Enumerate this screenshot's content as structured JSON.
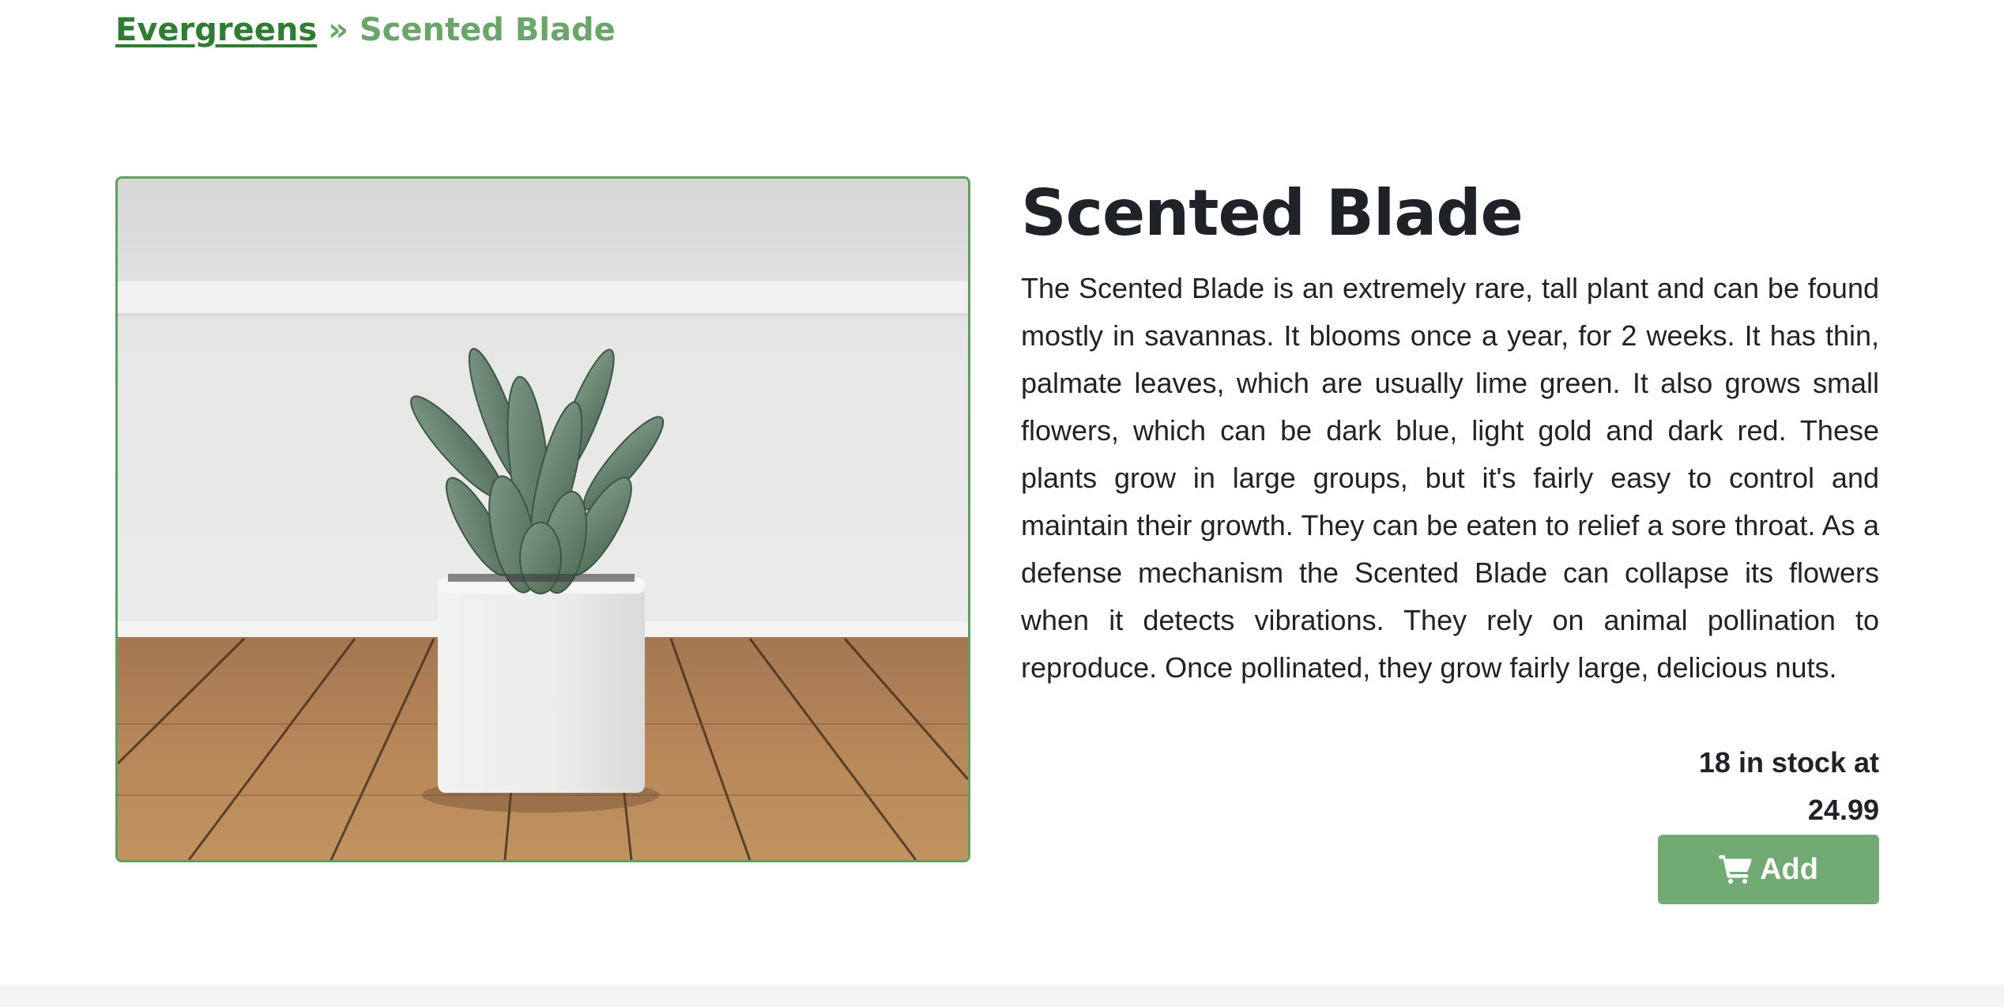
{
  "breadcrumb": {
    "parent_label": "Evergreens",
    "separator": " » ",
    "current_label": "Scented Blade"
  },
  "product": {
    "title": "Scented Blade",
    "image_description": "Succulent in a white square pot on a wooden floor",
    "description": "The Scented Blade is an extremely rare, tall plant and can be found mostly in savannas. It blooms once a year, for 2 weeks. It has thin, palmate leaves, which are usually lime green. It also grows small flowers, which can be dark blue, light gold and dark red. These plants grow in large groups, but it's fairly easy to control and maintain their growth. They can be eaten to relief a sore throat. As a defense mechanism the Scented Blade can collapse its flowers when it detects vibrations. They rely on animal pollination to reproduce. Once pollinated, they grow fairly large, delicious nuts.",
    "stock_count": "18",
    "stock_text": "in stock at",
    "price": "24.99"
  },
  "actions": {
    "add_label": "Add",
    "add_icon": "shopping-cart-icon"
  },
  "colors": {
    "accent": "#72aa73",
    "link": "#2e7d32",
    "breadcrumb_current": "#6aa56a",
    "image_border": "#5f9f63",
    "text": "#1f2328"
  }
}
